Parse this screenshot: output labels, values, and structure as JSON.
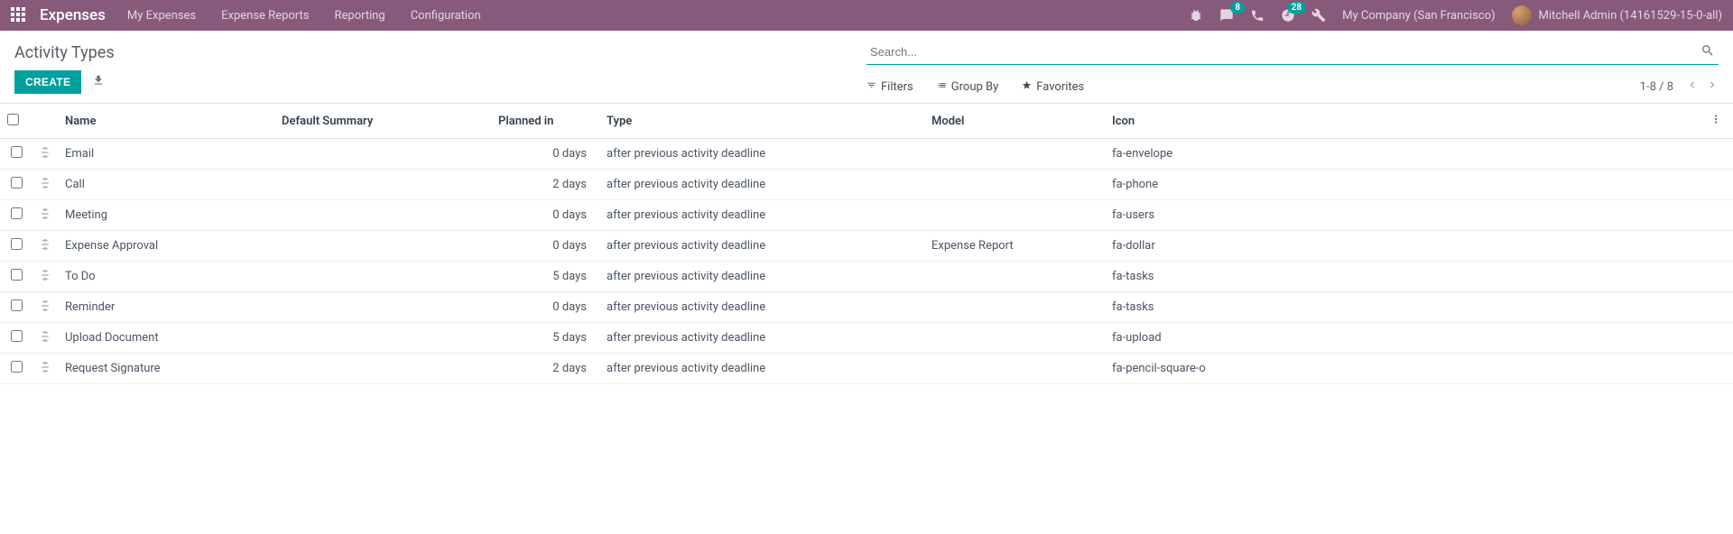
{
  "nav": {
    "brand": "Expenses",
    "menu": [
      "My Expenses",
      "Expense Reports",
      "Reporting",
      "Configuration"
    ],
    "chat_badge": "8",
    "clock_badge": "28",
    "company": "My Company (San Francisco)",
    "user": "Mitchell Admin (14161529-15-0-all)"
  },
  "breadcrumb": "Activity Types",
  "search": {
    "placeholder": "Search..."
  },
  "buttons": {
    "create": "CREATE"
  },
  "filters": {
    "filters": "Filters",
    "groupby": "Group By",
    "favorites": "Favorites"
  },
  "pager": {
    "text": "1-8 / 8"
  },
  "columns": {
    "name": "Name",
    "summary": "Default Summary",
    "planned": "Planned in",
    "type": "Type",
    "model": "Model",
    "icon": "Icon"
  },
  "rows": [
    {
      "name": "Email",
      "summary": "",
      "planned": "0 days",
      "type": "after previous activity deadline",
      "model": "",
      "icon": "fa-envelope"
    },
    {
      "name": "Call",
      "summary": "",
      "planned": "2 days",
      "type": "after previous activity deadline",
      "model": "",
      "icon": "fa-phone"
    },
    {
      "name": "Meeting",
      "summary": "",
      "planned": "0 days",
      "type": "after previous activity deadline",
      "model": "",
      "icon": "fa-users"
    },
    {
      "name": "Expense Approval",
      "summary": "",
      "planned": "0 days",
      "type": "after previous activity deadline",
      "model": "Expense Report",
      "icon": "fa-dollar"
    },
    {
      "name": "To Do",
      "summary": "",
      "planned": "5 days",
      "type": "after previous activity deadline",
      "model": "",
      "icon": "fa-tasks"
    },
    {
      "name": "Reminder",
      "summary": "",
      "planned": "0 days",
      "type": "after previous activity deadline",
      "model": "",
      "icon": "fa-tasks"
    },
    {
      "name": "Upload Document",
      "summary": "",
      "planned": "5 days",
      "type": "after previous activity deadline",
      "model": "",
      "icon": "fa-upload"
    },
    {
      "name": "Request Signature",
      "summary": "",
      "planned": "2 days",
      "type": "after previous activity deadline",
      "model": "",
      "icon": "fa-pencil-square-o"
    }
  ]
}
